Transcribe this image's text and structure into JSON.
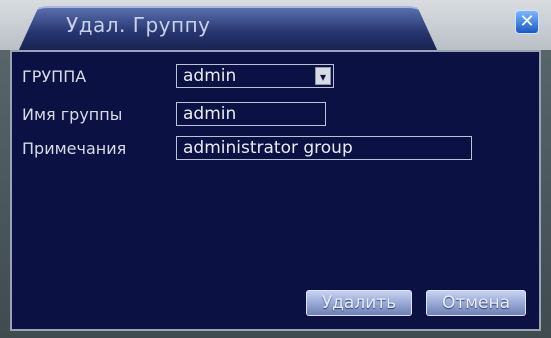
{
  "dialog": {
    "title": "Удал. Группу",
    "close_icon": "close-icon"
  },
  "form": {
    "group": {
      "label": "ГРУППА",
      "value": "admin"
    },
    "group_name": {
      "label": "Имя группы",
      "value": "admin"
    },
    "notes": {
      "label": "Примечания",
      "value": "administrator group"
    }
  },
  "buttons": {
    "delete": "Удалить",
    "cancel": "Отмена"
  },
  "colors": {
    "panel_bg": "#0b1243",
    "title_tab": "#26356f",
    "close_btn": "#1a58c4",
    "button": "#6c7fb8"
  }
}
